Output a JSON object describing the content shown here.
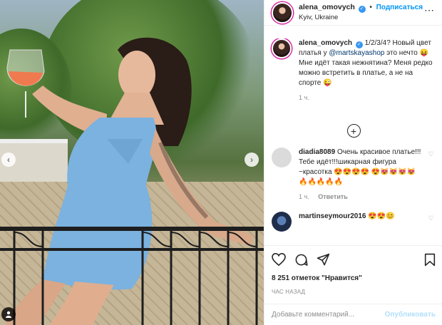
{
  "author": {
    "username": "alena_omovych",
    "follow_label": "Подписаться",
    "location": "Kyiv, Ukraine",
    "separator": "•"
  },
  "caption": {
    "username": "alena_omovych",
    "text_before": "1/2/3/4? Новый цвет платья у ",
    "mention": "@martskayashop",
    "text_after": " это нечто 😝 Мне идёт такая нежнятина? Меня редко можно встретить в платье, а не на спорте 😜",
    "time": "1 ч."
  },
  "comments": [
    {
      "username": "diadia8089",
      "text": "Очень красивое платье!!! Тебе идёт!!!шикарная фигура ~красотка 😍😍😍😍 😍😻😻😻😻🔥🔥🔥🔥🔥",
      "time": "1 ч.",
      "reply_label": "Ответить"
    },
    {
      "username": "martinseymour2016",
      "text": "😍😍😊"
    }
  ],
  "actions": {
    "likes": "8 251 отметок \"Нравится\"",
    "date": "ЧАС НАЗАД"
  },
  "composer": {
    "placeholder": "Добавьте комментарий...",
    "publish_label": "Опубликовать"
  },
  "icons": [
    "verified-icon",
    "more-icon",
    "heart-icon",
    "comment-icon",
    "share-icon",
    "bookmark-icon",
    "plus-circle-icon",
    "prev-arrow-icon",
    "next-arrow-icon",
    "user-tag-icon"
  ],
  "colors": {
    "link": "#0095f6",
    "mention": "#00376b",
    "muted": "#8e8e8e",
    "publish_disabled": "#b2dffc"
  }
}
